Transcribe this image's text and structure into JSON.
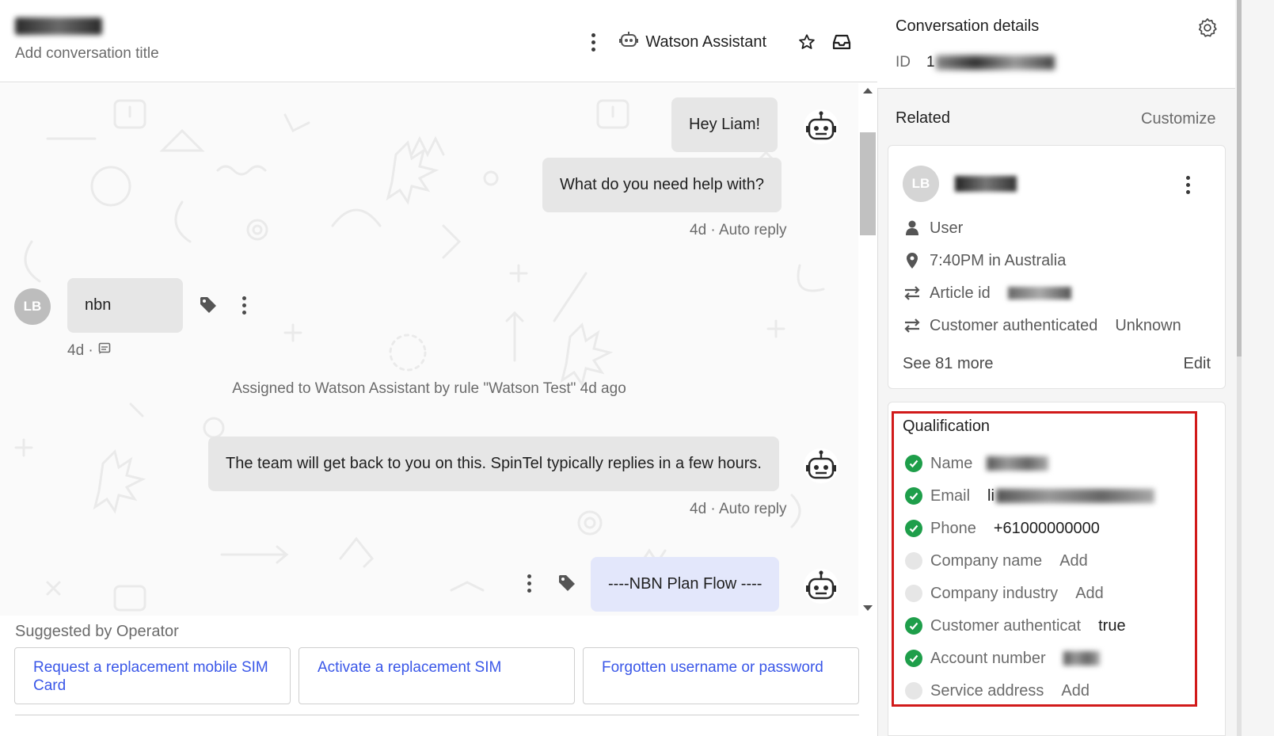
{
  "header": {
    "title_placeholder": "Add conversation title",
    "assignee": "Watson Assistant"
  },
  "messages": [
    {
      "text": "Hey Liam!"
    },
    {
      "text": "What do you need help with?"
    },
    {
      "meta": "4d · Auto reply"
    },
    {
      "text": "nbn",
      "avatar": "LB",
      "meta": "4d ·"
    },
    {
      "system": "Assigned to Watson Assistant by rule \"Watson Test\" 4d ago"
    },
    {
      "text": "The team will get back to you on this. SpinTel typically replies in a few hours."
    },
    {
      "meta": "4d · Auto reply"
    },
    {
      "text": "----NBN Plan Flow ----"
    }
  ],
  "suggestions": {
    "label": "Suggested by Operator",
    "items": [
      "Request a replacement mobile SIM Card",
      "Activate a replacement SIM",
      "Forgotten username or password"
    ]
  },
  "details": {
    "title": "Conversation details",
    "id_label": "ID",
    "id_value_visible": "1"
  },
  "related": {
    "title": "Related",
    "customize": "Customize",
    "avatar": "LB",
    "rows": [
      {
        "icon": "person-icon",
        "label": "User"
      },
      {
        "icon": "location-pin-icon",
        "label": "7:40PM in Australia"
      },
      {
        "icon": "swap-arrows-icon",
        "label": "Article id"
      },
      {
        "icon": "swap-arrows-icon",
        "label": "Customer authenticated",
        "value": "Unknown"
      }
    ],
    "see_more": "See 81 more",
    "edit": "Edit"
  },
  "qualification": {
    "title": "Qualification",
    "rows": [
      {
        "label": "Name",
        "status": "complete"
      },
      {
        "label": "Email",
        "status": "complete",
        "value_prefix": "li"
      },
      {
        "label": "Phone",
        "status": "complete",
        "value": "+61000000000"
      },
      {
        "label": "Company name",
        "status": "empty",
        "action": "Add"
      },
      {
        "label": "Company industry",
        "status": "empty",
        "action": "Add"
      },
      {
        "label": "Customer authenticat",
        "status": "complete",
        "value": "true"
      },
      {
        "label": "Account number",
        "status": "complete"
      },
      {
        "label": "Service address",
        "status": "empty",
        "action": "Add"
      }
    ]
  },
  "colors": {
    "accent_link": "#3a57e8",
    "check_green": "#1e9e4a",
    "highlight_red": "#d11a1a",
    "flow_bubble": "#e3e7fb"
  }
}
